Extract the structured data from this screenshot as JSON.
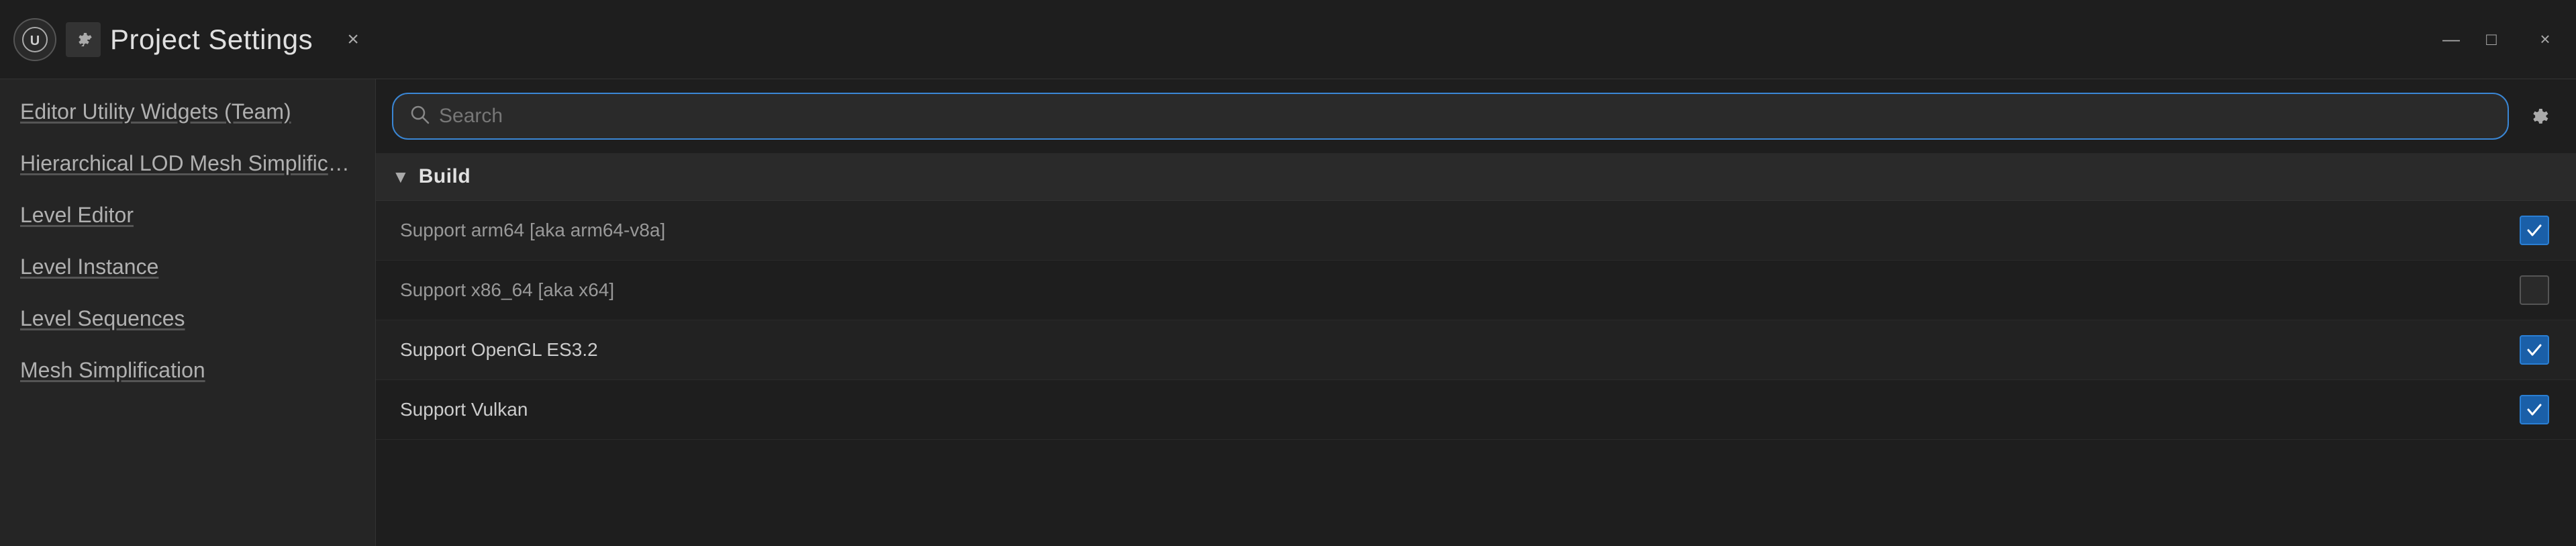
{
  "window": {
    "title": "Project Settings",
    "close_label": "×",
    "minimize_label": "—",
    "maximize_label": "□"
  },
  "sidebar": {
    "items": [
      {
        "label": "Editor Utility Widgets (Team)",
        "id": "editor-utility-widgets"
      },
      {
        "label": "Hierarchical LOD Mesh Simplification",
        "id": "hierarchical-lod"
      },
      {
        "label": "Level Editor",
        "id": "level-editor"
      },
      {
        "label": "Level Instance",
        "id": "level-instance"
      },
      {
        "label": "Level Sequences",
        "id": "level-sequences"
      },
      {
        "label": "Mesh Simplification",
        "id": "mesh-simplification"
      }
    ]
  },
  "search": {
    "placeholder": "Search"
  },
  "build_section": {
    "title": "Build",
    "settings": [
      {
        "label": "Support arm64 [aka arm64-v8a]",
        "checked": true,
        "dimmed": true
      },
      {
        "label": "Support x86_64 [aka x64]",
        "checked": false,
        "dimmed": true
      },
      {
        "label": "Support OpenGL ES3.2",
        "checked": true,
        "dimmed": false
      },
      {
        "label": "Support Vulkan",
        "checked": true,
        "dimmed": false
      }
    ]
  },
  "icons": {
    "ue_logo": "⬡",
    "settings_gear": "⚙",
    "search": "🔍",
    "gear": "⚙",
    "checkmark": "✓",
    "arrow_down": "▼"
  }
}
